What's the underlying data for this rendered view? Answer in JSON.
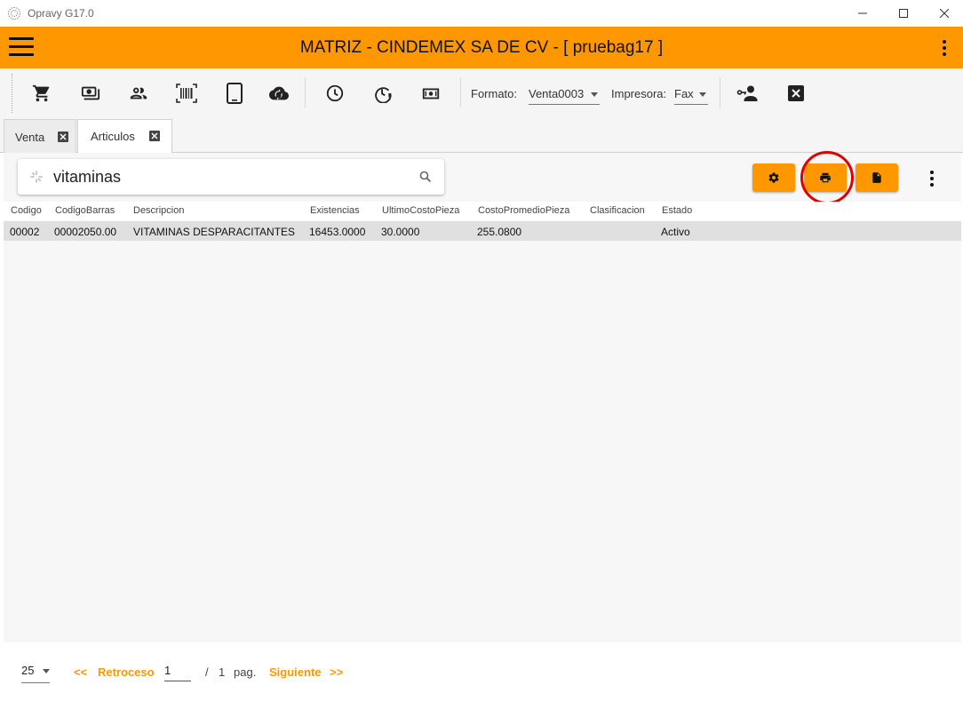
{
  "window": {
    "title": "Opravy G17.0"
  },
  "appbar": {
    "title": "MATRIZ - CINDEMEX SA DE CV - [ pruebag17 ]"
  },
  "toolbar": {
    "icons": [
      "cart-icon",
      "cash-icon",
      "people-icon",
      "barcode-icon",
      "tablet-icon",
      "cloud-sync-icon",
      "clock-icon",
      "clock-alert-icon",
      "money-icon"
    ],
    "formato_label": "Formato:",
    "formato_value": "Venta0003",
    "impresora_label": "Impresora:",
    "impresora_value": "Fax"
  },
  "tabs": [
    {
      "label": "Venta",
      "active": false
    },
    {
      "label": "Articulos",
      "active": true
    }
  ],
  "search": {
    "value": "vitaminas"
  },
  "table": {
    "columns": [
      "Codigo",
      "CodigoBarras",
      "Descripcion",
      "Existencias",
      "UltimoCostoPieza",
      "CostoPromedioPieza",
      "Clasificacion",
      "Estado"
    ],
    "rows": [
      [
        "00002",
        "00002050.00",
        "VITAMINAS DESPARACITANTES",
        "16453.0000",
        "30.0000",
        "255.0800",
        "",
        "Activo"
      ]
    ]
  },
  "pager": {
    "page_size": "25",
    "prev_arrows": "<<",
    "prev_label": "Retroceso",
    "current_page": "1",
    "separator": "/",
    "total_pages": "1",
    "pag_label": "pag.",
    "next_label": "Siguiente",
    "next_arrows": ">>"
  },
  "colors": {
    "accent": "#ff9800",
    "highlight": "#e00000"
  }
}
